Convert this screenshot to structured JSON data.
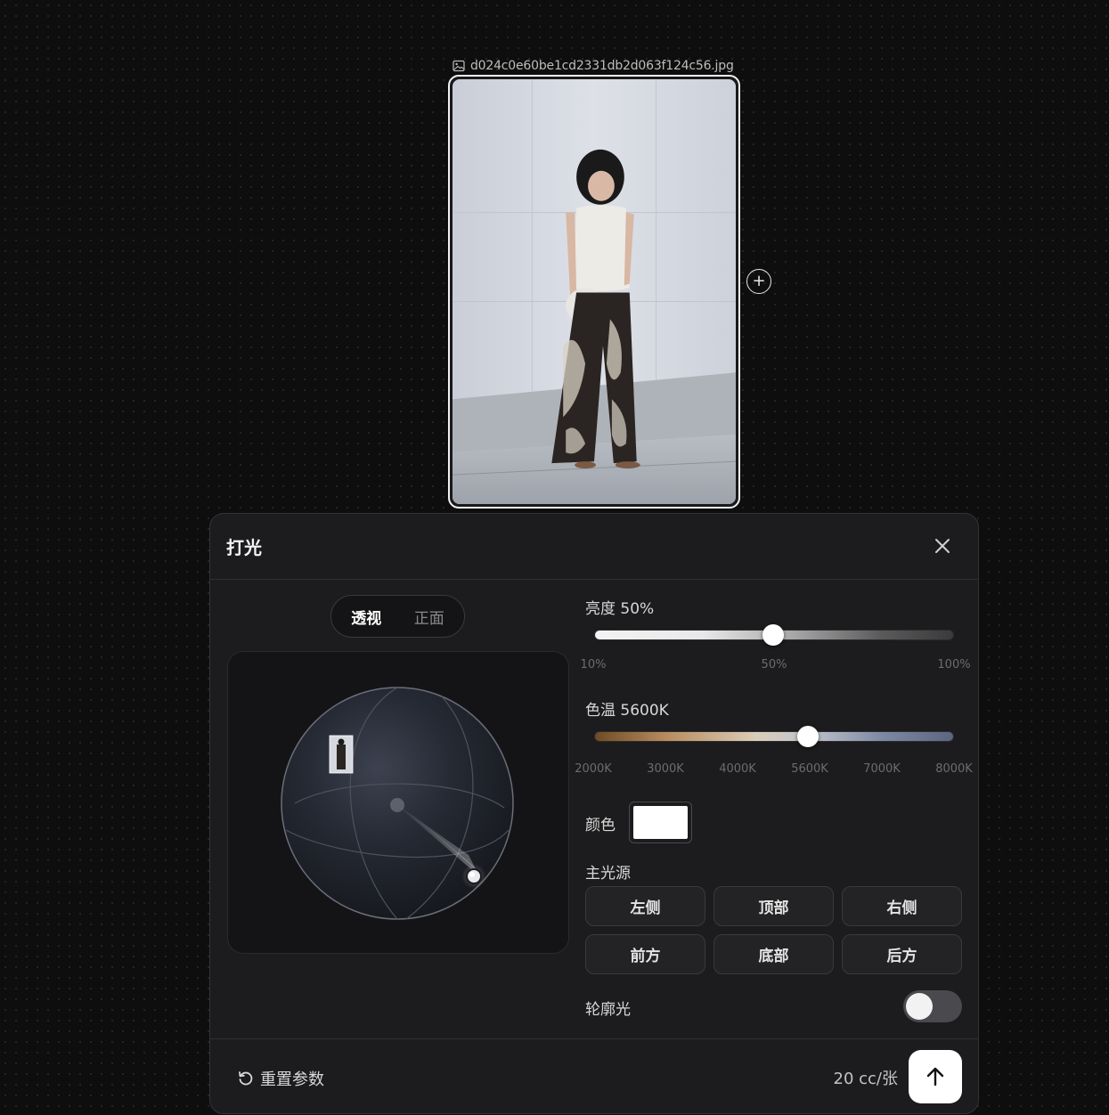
{
  "canvas": {
    "file_name": "d024c0e60be1cd2331db2d063f124c56.jpg",
    "add_node_symbol": "+"
  },
  "panel": {
    "title": "打光",
    "close_icon": "close-icon",
    "view_tabs": [
      {
        "label": "透视",
        "active": true
      },
      {
        "label": "正面",
        "active": false
      }
    ],
    "brightness": {
      "label": "亮度 50%",
      "value_percent": 50,
      "min_label": "10%",
      "mid_label": "50%",
      "max_label": "100%"
    },
    "color_temperature": {
      "label": "色温 5600K",
      "value_k": 5600,
      "ticks": [
        "2000K",
        "3000K",
        "4000K",
        "5600K",
        "7000K",
        "8000K"
      ]
    },
    "color": {
      "label": "颜色",
      "value": "#ffffff"
    },
    "main_light": {
      "label": "主光源",
      "options": [
        "左侧",
        "顶部",
        "右侧",
        "前方",
        "底部",
        "后方"
      ]
    },
    "rim_light": {
      "label": "轮廓光",
      "enabled": false
    },
    "footer": {
      "reset_label": "重置参数",
      "cost": "20 cc/张",
      "submit_icon": "arrow-up-icon"
    }
  }
}
